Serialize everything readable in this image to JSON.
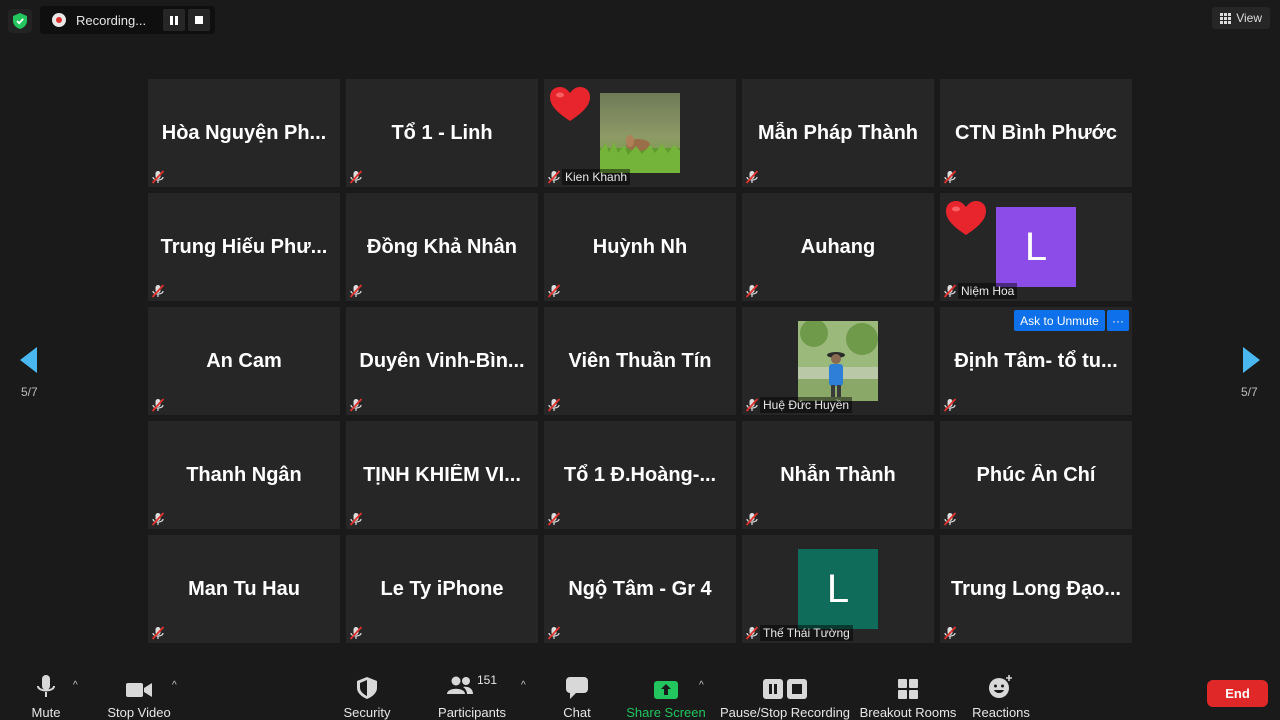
{
  "top_bar": {
    "recording_label": "Recording...",
    "view_label": "View"
  },
  "tiles": [
    {
      "name": "Hòa  Nguyện  Ph...",
      "type": "name"
    },
    {
      "name": "Tổ 1 - Linh",
      "type": "name"
    },
    {
      "label": "Kien Khanh",
      "type": "photo",
      "photo": "grass",
      "reaction": "heart"
    },
    {
      "name": "Mẫn Pháp Thành",
      "type": "name"
    },
    {
      "name": "CTN Bình Phước",
      "type": "name"
    },
    {
      "name": "Trung  Hiếu  Phư...",
      "type": "name"
    },
    {
      "name": "Đồng Khả Nhân",
      "type": "name"
    },
    {
      "name": "Huỳnh Nh",
      "type": "name"
    },
    {
      "name": "Auhang",
      "type": "name"
    },
    {
      "label": "Niệm Hoa",
      "type": "avatar",
      "letter": "L",
      "color": "#8b4ce8",
      "reaction": "heart"
    },
    {
      "name": "An Cam",
      "type": "name"
    },
    {
      "name": "Duyên  Vinh-Bìn...",
      "type": "name"
    },
    {
      "name": "Viên Thuần Tín",
      "type": "name"
    },
    {
      "label": "Huệ Đức Huyền",
      "type": "photo",
      "photo": "person"
    },
    {
      "name": "Định  Tâm-  tổ  tu...",
      "type": "name",
      "ask_unmute": "Ask to Unmute",
      "more": "···"
    },
    {
      "name": "Thanh Ngân",
      "type": "name"
    },
    {
      "name": "TỊNH  KHIÊM  VI...",
      "type": "name"
    },
    {
      "name": "Tổ  1  Đ.Hoàng-...",
      "type": "name"
    },
    {
      "name": "Nhẫn Thành",
      "type": "name"
    },
    {
      "name": "Phúc Ân Chí",
      "type": "name"
    },
    {
      "name": "Man Tu Hau",
      "type": "name"
    },
    {
      "name": "Le Ty iPhone",
      "type": "name"
    },
    {
      "name": "Ngộ Tâm - Gr 4",
      "type": "name"
    },
    {
      "label": "Thế Thái Tường",
      "type": "avatar",
      "letter": "L",
      "color": "#0f6b5a"
    },
    {
      "name": "Trung  Long  Đạo...",
      "type": "name"
    }
  ],
  "pagination": {
    "left": "5/7",
    "right": "5/7"
  },
  "toolbar": {
    "mute": "Mute",
    "stop_video": "Stop Video",
    "security": "Security",
    "participants": "Participants",
    "participant_count": "151",
    "chat": "Chat",
    "share_screen": "Share Screen",
    "pause_stop_recording": "Pause/Stop Recording",
    "breakout_rooms": "Breakout Rooms",
    "reactions": "Reactions",
    "end": "End"
  },
  "colors": {
    "accent_blue": "#0e71eb",
    "share_green": "#22c55e",
    "end_red": "#e02828",
    "arrow_blue": "#4ab8f0"
  }
}
